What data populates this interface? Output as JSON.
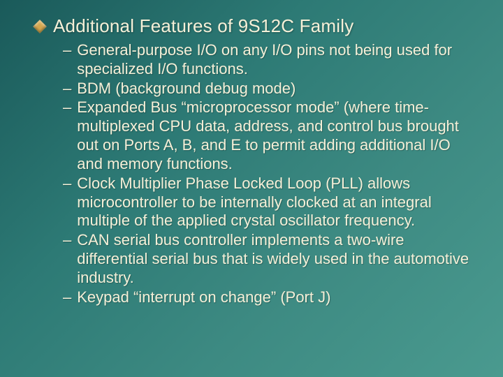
{
  "slide": {
    "heading": "Additional Features of 9S12C Family",
    "items": [
      "General-purpose I/O on any I/O pins not being used for specialized I/O functions.",
      "BDM (background debug mode)",
      "Expanded Bus “microprocessor mode” (where time-multiplexed CPU data, address, and control bus brought out on Ports A, B, and E to permit adding additional I/O and memory functions.",
      "Clock Multiplier Phase Locked Loop (PLL) allows microcontroller to be internally clocked at an integral multiple of the applied crystal oscillator frequency.",
      "CAN serial bus controller implements a two-wire differential serial bus that is widely used in the automotive industry.",
      "Keypad “interrupt on change” (Port J)"
    ]
  }
}
